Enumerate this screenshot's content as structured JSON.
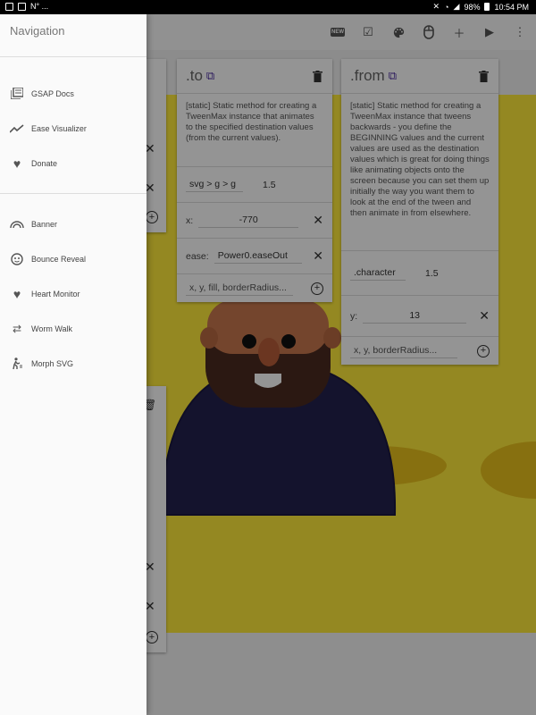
{
  "status_bar": {
    "left_text": "N° ...",
    "battery": "98%",
    "time": "10:54 PM"
  },
  "toolbar": {
    "icons": [
      "new-icon",
      "checkbox-icon",
      "palette-icon",
      "mouse-icon",
      "add-icon",
      "play-icon",
      "more-icon"
    ],
    "new_label": "NEW"
  },
  "navigation": {
    "title": "Navigation",
    "primary": [
      {
        "label": "GSAP Docs",
        "icon": "library-books-icon"
      },
      {
        "label": "Ease Visualizer",
        "icon": "trending-icon"
      },
      {
        "label": "Donate",
        "icon": "heart-icon"
      }
    ],
    "demos": [
      {
        "label": "Banner",
        "icon": "rainbow-icon"
      },
      {
        "label": "Bounce Reveal",
        "icon": "face-icon"
      },
      {
        "label": "Heart Monitor",
        "icon": "heart-icon"
      },
      {
        "label": "Worm Walk",
        "icon": "swap-icon"
      },
      {
        "label": "Morph SVG",
        "icon": "walk-icon"
      }
    ]
  },
  "cards": {
    "to": {
      "method": ".to",
      "description": "[static] Static method for creating a TweenMax instance that animates to the specified destination values (from the current values).",
      "target": "svg > g > g",
      "duration": "1.5",
      "prop_label": "x:",
      "prop_value": "-770",
      "ease_label": "ease:",
      "ease_value": "Power0.easeOut",
      "add_placeholder": "x, y, fill, borderRadius..."
    },
    "from": {
      "method": ".from",
      "description": "[static] Static method for creating a TweenMax instance that tweens backwards - you define the BEGINNING values and the current values are used as the destination values which is great for doing things like animating objects onto the screen because you can set them up initially the way you want them to look at the end of the tween and then animate in from elsewhere.",
      "target": ".character",
      "duration": "1.5",
      "prop_label": "y:",
      "prop_value": "13",
      "add_placeholder": "x, y, borderRadius..."
    }
  },
  "colors": {
    "stage": "#ffeb3b",
    "accent": "#4a2ea0",
    "shirt": "#24214f",
    "beard": "#4a2a1f",
    "skin": "#c8784e"
  }
}
